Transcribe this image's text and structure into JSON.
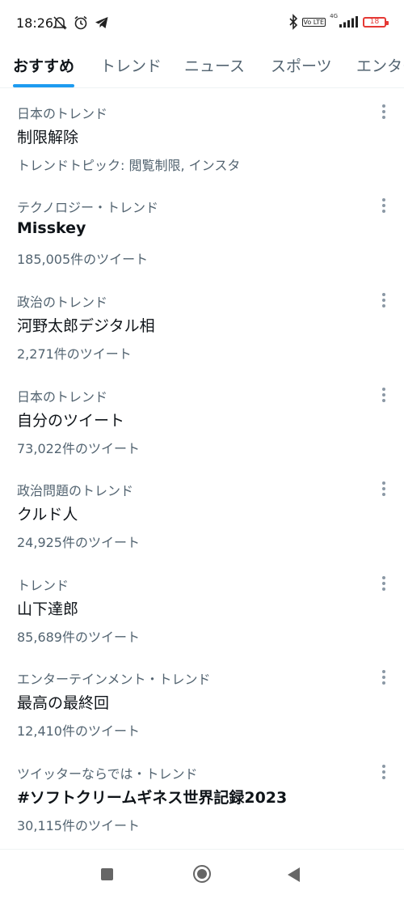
{
  "status_bar": {
    "time": "18:26",
    "network": "4G",
    "volte": "Vo LTE",
    "battery": "18",
    "battery_color": "#e53935"
  },
  "tabs": [
    {
      "label": "おすすめ",
      "active": true
    },
    {
      "label": "トレンド",
      "active": false
    },
    {
      "label": "ニュース",
      "active": false
    },
    {
      "label": "スポーツ",
      "active": false
    },
    {
      "label": "エンター",
      "active": false
    }
  ],
  "accent_color": "#1d9bf0",
  "trends": [
    {
      "category": "日本のトレンド",
      "title": "制限解除",
      "subtitle": "トレンドトピック: 閲覧制限, インスタ"
    },
    {
      "category": "テクノロジー・トレンド",
      "title": "Misskey",
      "subtitle": "185,005件のツイート"
    },
    {
      "category": "政治のトレンド",
      "title": "河野太郎デジタル相",
      "subtitle": "2,271件のツイート"
    },
    {
      "category": "日本のトレンド",
      "title": "自分のツイート",
      "subtitle": "73,022件のツイート"
    },
    {
      "category": "政治問題のトレンド",
      "title": "クルド人",
      "subtitle": "24,925件のツイート"
    },
    {
      "category": "トレンド",
      "title": "山下達郎",
      "subtitle": "85,689件のツイート"
    },
    {
      "category": "エンターテインメント・トレンド",
      "title": "最高の最終回",
      "subtitle": "12,410件のツイート"
    },
    {
      "category": "ツイッターならでは・トレンド",
      "title": "#ソフトクリームギネス世界記録2023",
      "subtitle": "30,115件のツイート"
    }
  ],
  "nav_bar": {
    "icons": [
      "recents-icon",
      "home-icon",
      "back-icon"
    ]
  }
}
